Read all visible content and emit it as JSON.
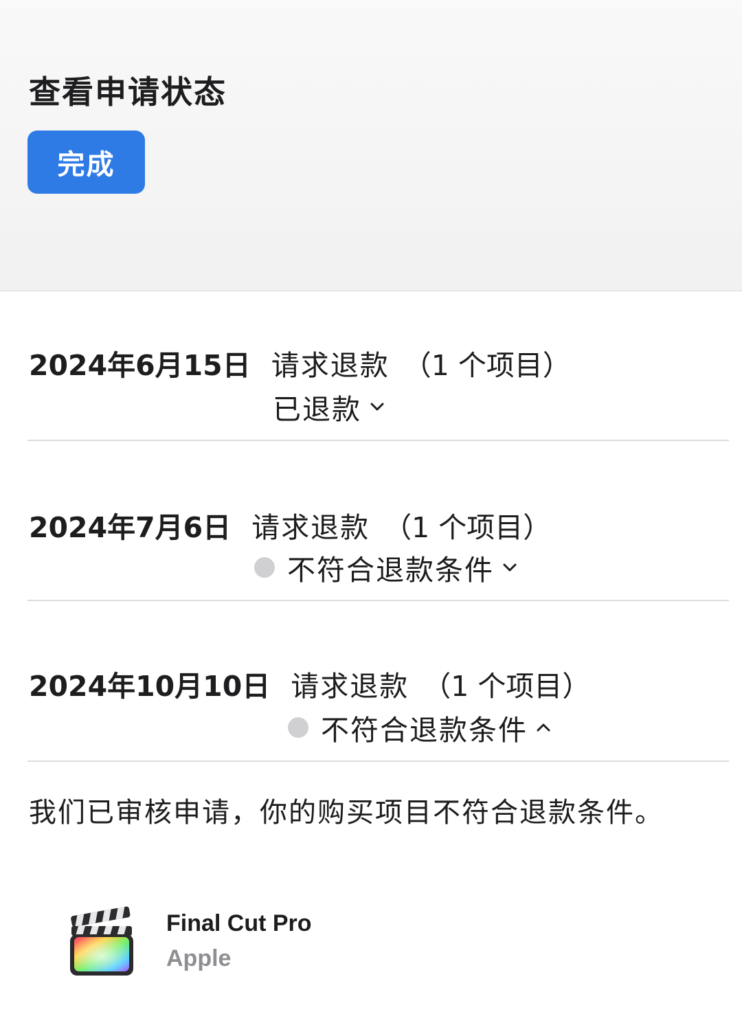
{
  "header": {
    "title": "查看申请状态",
    "done_label": "完成"
  },
  "requests": [
    {
      "date": "2024年6月15日",
      "type": "请求退款",
      "count": "（1 个项目）",
      "status": "已退款",
      "status_dot": false,
      "expanded": false
    },
    {
      "date": "2024年7月6日",
      "type": "请求退款",
      "count": "（1 个项目）",
      "status": "不符合退款条件",
      "status_dot": true,
      "expanded": false
    },
    {
      "date": "2024年10月10日",
      "type": "请求退款",
      "count": "（1 个项目）",
      "status": "不符合退款条件",
      "status_dot": true,
      "expanded": true
    }
  ],
  "detail": {
    "message": "我们已审核申请，你的购买项目不符合退款条件。",
    "app_name": "Final Cut Pro",
    "app_developer": "Apple",
    "app_icon": "final-cut-pro-icon"
  },
  "colors": {
    "accent": "#2f7be6",
    "status_dot": "#d0d0d3",
    "secondary_text": "#8e8e93"
  }
}
